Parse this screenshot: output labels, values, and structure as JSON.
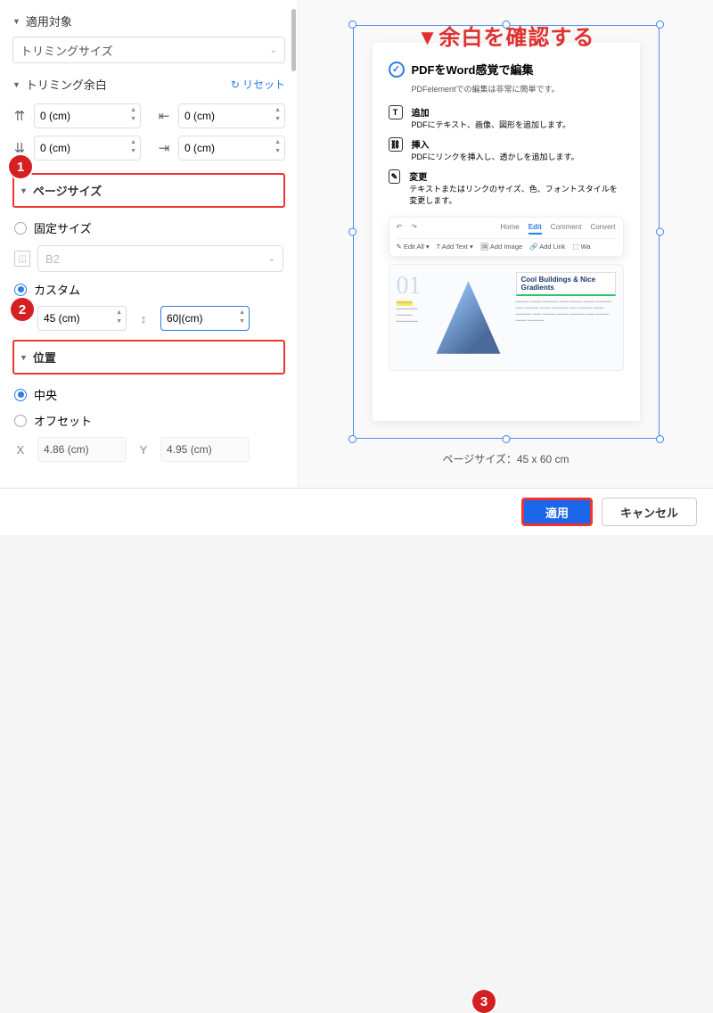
{
  "sections": {
    "target": "適用対象",
    "trimming": "トリミング余白",
    "pagesize": "ページサイズ",
    "position": "位置"
  },
  "trimsize_dropdown": "トリミングサイズ",
  "reset": "リセット",
  "margins": {
    "top": "0 (cm)",
    "left": "0 (cm)",
    "bottom": "0 (cm)",
    "right": "0 (cm)"
  },
  "pagesize": {
    "fixed": "固定サイズ",
    "fixed_value": "B2",
    "custom": "カスタム",
    "width": "45 (cm)",
    "height": "60|(cm)"
  },
  "position": {
    "center": "中央",
    "offset": "オフセット",
    "x": "4.86 (cm)",
    "y": "4.95 (cm)"
  },
  "annotation": "▼余白を確認する",
  "preview": {
    "title": "PDFをWord感覚で編集",
    "subtitle": "PDFelementでの編集は非常に簡単です。",
    "feat1_t": "追加",
    "feat1_d": "PDFにテキスト、画像、図形を追加します。",
    "feat2_t": "挿入",
    "feat2_d": "PDFにリンクを挿入し、透かしを追加します。",
    "feat3_t": "変更",
    "feat3_d": "テキストまたはリンクのサイズ、色、フォントスタイルを変更します。",
    "tabs": {
      "home": "Home",
      "edit": "Edit",
      "comment": "Comment",
      "convert": "Convert"
    },
    "tools": {
      "editall": "Edit All",
      "addtext": "Add Text",
      "addimage": "Add Image",
      "addlink": "Add Link",
      "wa": "Wa"
    },
    "cool": "Cool Buildings & Nice Gradients",
    "num": "01"
  },
  "page_size_label": "ページサイズ：45 x 60 cm",
  "buttons": {
    "apply": "適用",
    "cancel": "キャンセル"
  },
  "badges": {
    "b1": "1",
    "b2": "2",
    "b3": "3"
  },
  "x_label": "X",
  "y_label": "Y"
}
